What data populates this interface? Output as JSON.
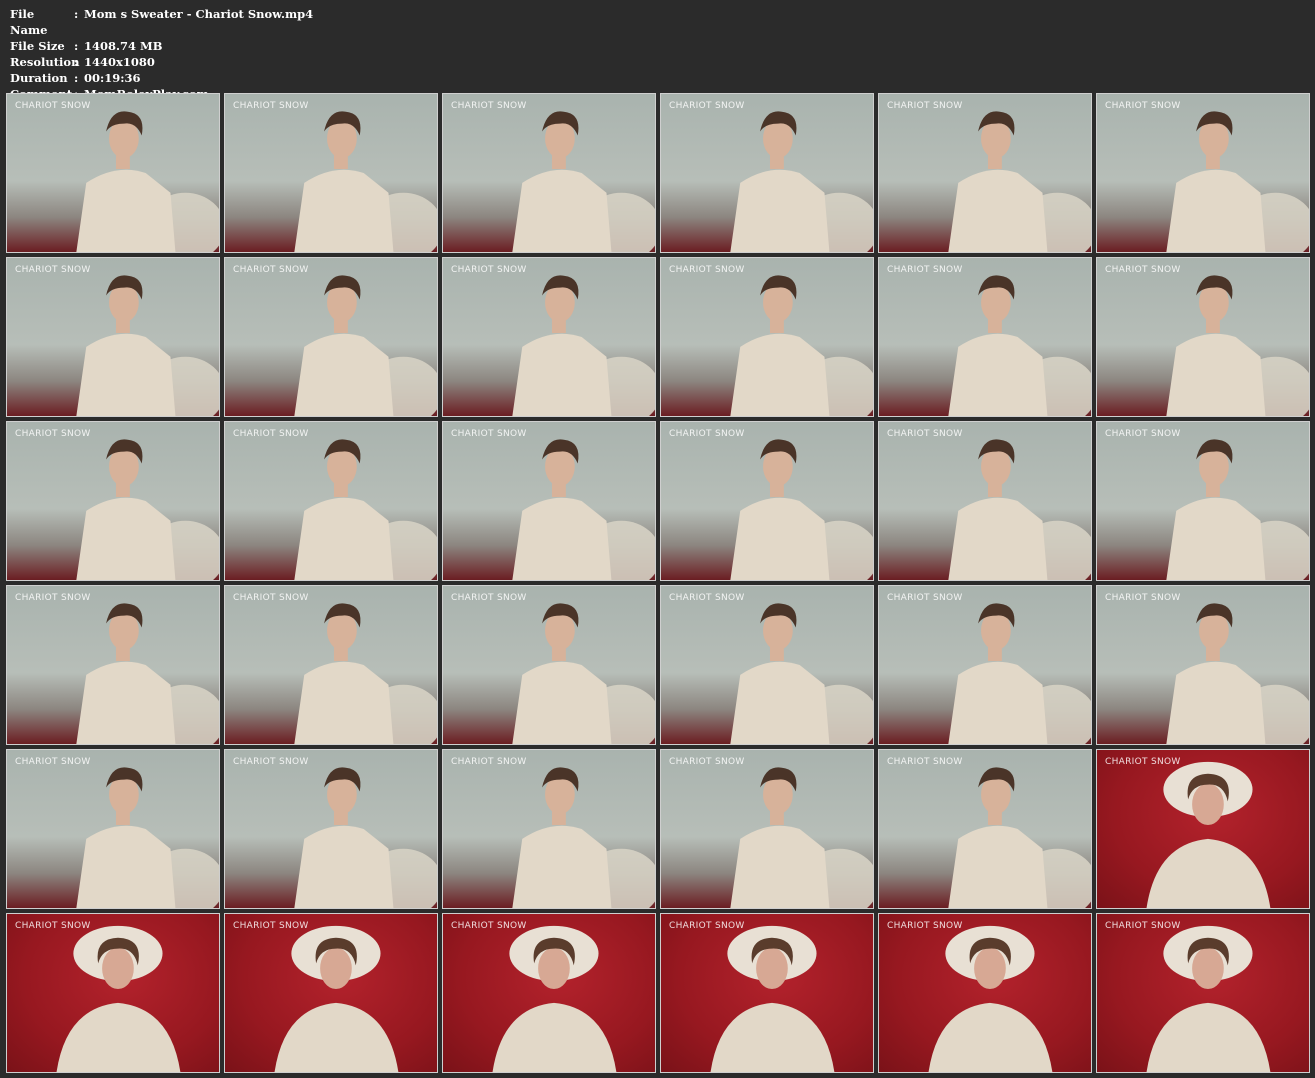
{
  "info": {
    "rows": [
      {
        "label": "File Name",
        "sep": ":",
        "value": "Mom s Sweater - Chariot Snow.mp4"
      },
      {
        "label": "File Size",
        "sep": ":",
        "value": "1408.74 MB"
      },
      {
        "label": "Resolution",
        "sep": ":",
        "value": "1440x1080"
      },
      {
        "label": "Duration",
        "sep": ":",
        "value": "00:19:36"
      },
      {
        "label": "Comment",
        "sep": ":",
        "value": "MomRoleyPlay.com"
      }
    ]
  },
  "watermark": "CHARIOT SNOW",
  "colors": {
    "background": "#2b2b2b",
    "wall": "#b0b8b3",
    "bed": "#a61d26",
    "sweater": "#e2d8c8"
  },
  "thumbnails": [
    "wall",
    "wall",
    "wall",
    "wall",
    "wall",
    "wall",
    "wall",
    "wall",
    "wall",
    "wall",
    "wall",
    "wall",
    "wall",
    "wall",
    "wall",
    "wall",
    "wall",
    "wall",
    "wall",
    "wall",
    "wall",
    "wall",
    "wall",
    "wall",
    "wall",
    "wall",
    "wall",
    "wall",
    "wall",
    "bed",
    "bed",
    "bed",
    "bed",
    "bed",
    "bed",
    "bed"
  ]
}
